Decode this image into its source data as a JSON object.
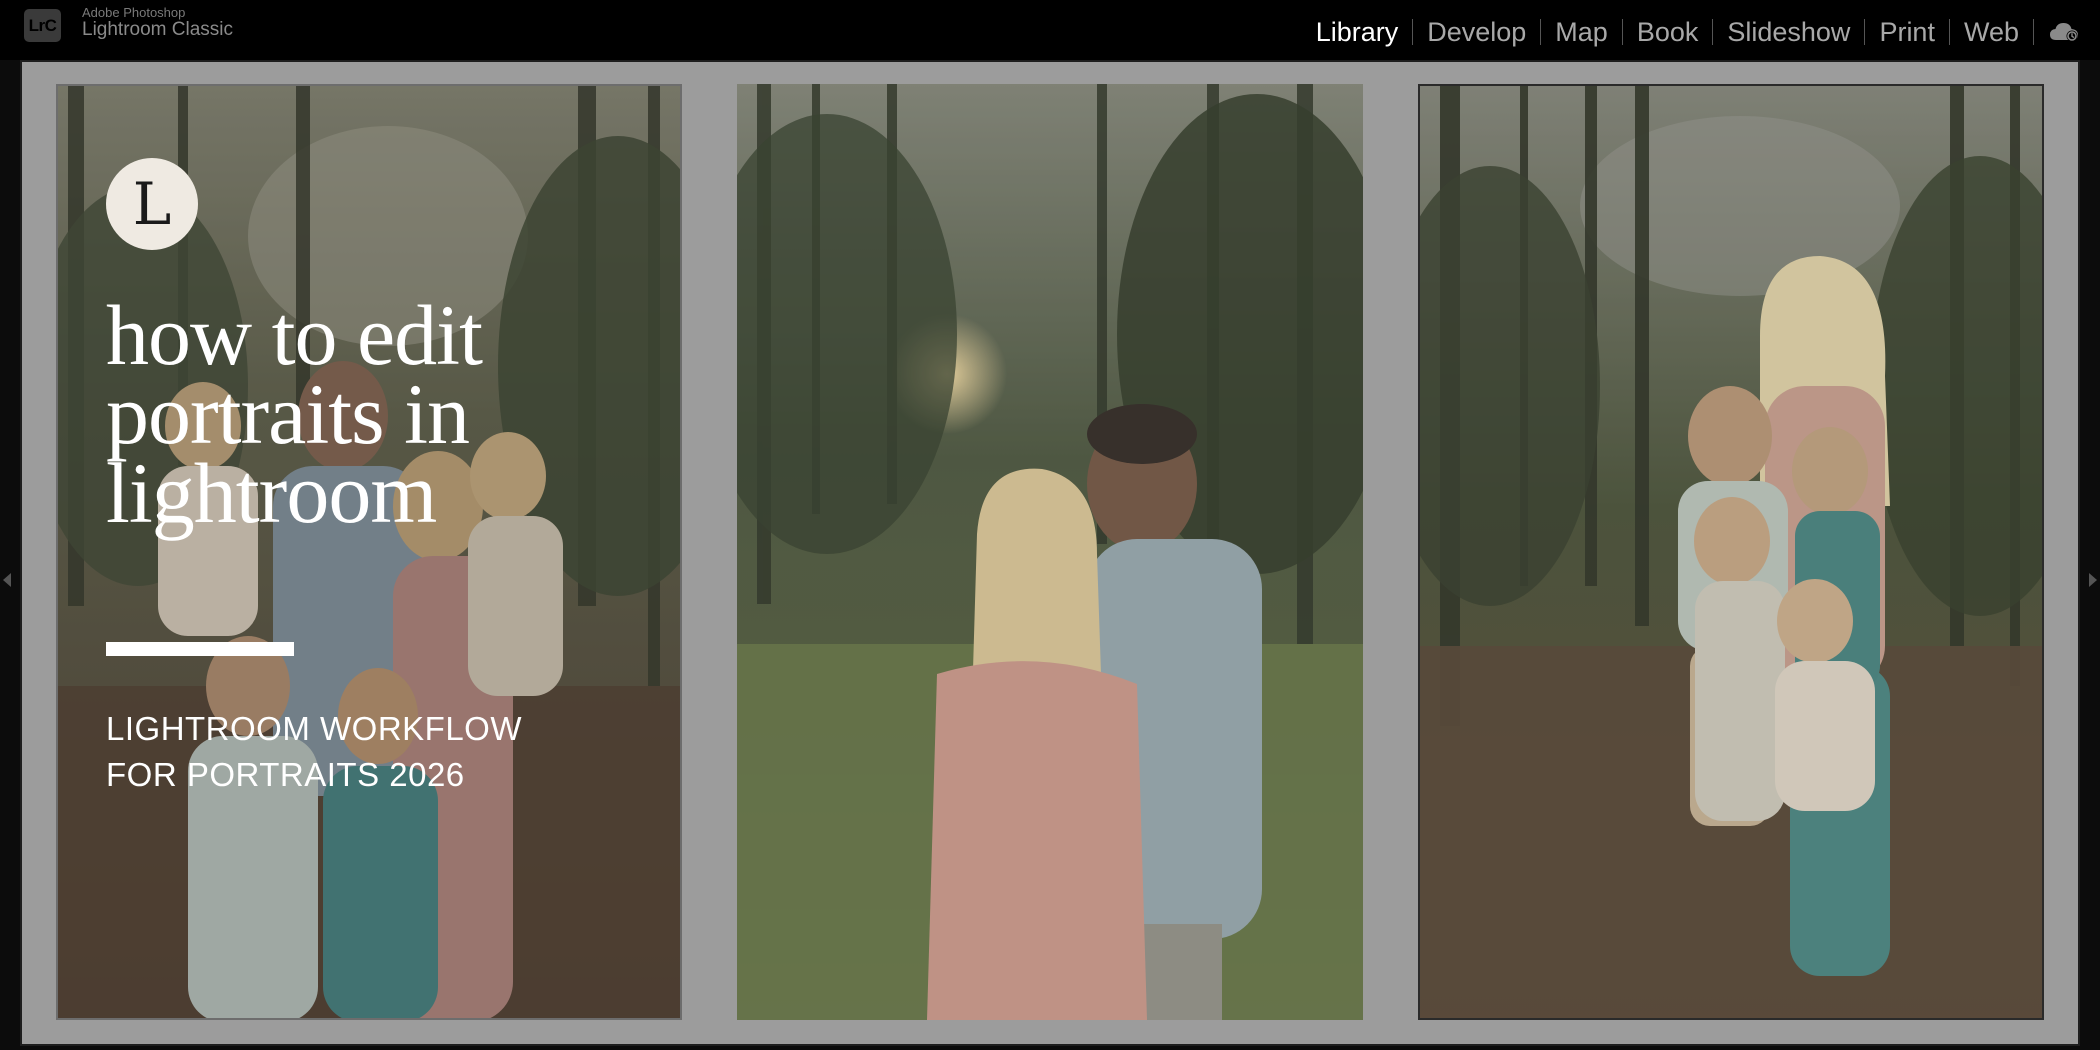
{
  "app": {
    "logo": "LrC",
    "vendor": "Adobe Photoshop",
    "product": "Lightroom Classic"
  },
  "modules": [
    "Library",
    "Develop",
    "Map",
    "Book",
    "Slideshow",
    "Print",
    "Web"
  ],
  "active_module": "Library",
  "icons": [
    "cloud-sync-icon",
    "left-panel-toggle-icon",
    "right-panel-toggle-icon"
  ],
  "overlay": {
    "brand_letter": "L",
    "headline": "how to edit portraits in lightroom",
    "subheading": "LIGHTROOM WORKFLOW FOR PORTRAITS 2026"
  },
  "colors": {
    "topbar": "#000000",
    "canvas": "#9c9c9c",
    "active_module": "#ffffff",
    "inactive_module": "#a8a8a8"
  }
}
